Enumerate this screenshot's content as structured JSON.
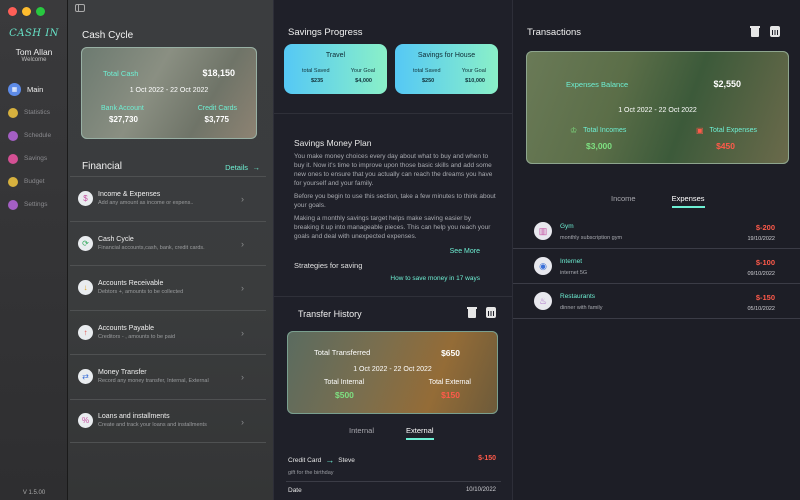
{
  "app": {
    "logo": "CASH IN",
    "user_name": "Tom Allan",
    "user_greeting": "Welcome",
    "version": "V 1.5.00"
  },
  "sidebar": {
    "items": [
      {
        "label": "Main",
        "icon": "home-icon",
        "color": "#5d8be8"
      },
      {
        "label": "Statistics",
        "icon": "chart-icon",
        "color": "#f2c94c"
      },
      {
        "label": "Schedule",
        "icon": "schedule-icon",
        "color": "#bb6bd9"
      },
      {
        "label": "Savings",
        "icon": "savings-icon",
        "color": "#eb5aa8"
      },
      {
        "label": "Budget",
        "icon": "budget-icon",
        "color": "#f2c94c"
      },
      {
        "label": "Settings",
        "icon": "gear-icon",
        "color": "#bb6bd9"
      }
    ]
  },
  "cash_cycle": {
    "title": "Cash Cycle",
    "total_label": "Total Cash",
    "total_value": "$18,150",
    "date_range": "1 Oct 2022 - 22 Oct 2022",
    "bank_label": "Bank Account",
    "bank_value": "$27,730",
    "credit_label": "Credit Cards",
    "credit_value": "$3,775"
  },
  "financial": {
    "title": "Financial",
    "details": "Details",
    "items": [
      {
        "title": "Income & Expenses",
        "subtitle": "Add any amount as income or expens..",
        "icon": "wallet-icon"
      },
      {
        "title": "Cash Cycle",
        "subtitle": "Financial accounts,cash, bank, credit cards.",
        "icon": "cash-cycle-icon"
      },
      {
        "title": "Accounts Receivable",
        "subtitle": "Debtors +, amounts to be collected",
        "icon": "receivable-icon"
      },
      {
        "title": "Accounts Payable",
        "subtitle": "Creditors - , amounts to be paid",
        "icon": "payable-icon"
      },
      {
        "title": "Money Transfer",
        "subtitle": "Record any money transfer, Internal, External",
        "icon": "transfer-icon"
      },
      {
        "title": "Loans and installments",
        "subtitle": "Create and track your loans and installments",
        "icon": "loan-icon"
      }
    ]
  },
  "savings": {
    "title": "Savings Progress",
    "goals": [
      {
        "name": "Travel",
        "saved_label": "total Saved",
        "saved": "$235",
        "goal_label": "Your Goal",
        "goal": "$4,000"
      },
      {
        "name": "Savings for House",
        "saved_label": "total Saved",
        "saved": "$250",
        "goal_label": "Your Goal",
        "goal": "$10,000"
      }
    ],
    "plan_title": "Savings Money Plan",
    "plan_paragraphs": [
      "You make money choices every day about what to buy and when to buy it. Now it's time to improve upon those basic skills and add some new ones to ensure that you actually can reach the dreams you have for yourself and your family.",
      "Before you begin to use this section, take a few minutes to think about your goals.",
      "Making a monthly savings target helps make saving easier by breaking it up into manageable pieces. This can help you reach your goals and deal with unexpected expenses."
    ],
    "see_more": "See More",
    "strategies_title": "Strategies for saving",
    "strategies_link": "How to save money in 17 ways"
  },
  "transfer_history": {
    "title": "Transfer History",
    "total_label": "Total Transferred",
    "total_value": "$650",
    "date_range": "1 Oct 2022 - 22 Oct 2022",
    "internal_label": "Total Internal",
    "internal_value": "$500",
    "external_label": "Total External",
    "external_value": "$150",
    "tabs": [
      "Internal",
      "External"
    ],
    "active_tab": 1,
    "rows": [
      {
        "from": "Credit Card",
        "to": "Steve",
        "note": "gift for the birthday",
        "amount": "$-150"
      },
      {
        "label": "Date",
        "value": "10/10/2022"
      }
    ]
  },
  "transactions": {
    "title": "Transactions",
    "balance_label": "Expenses Balance",
    "balance_value": "$2,550",
    "date_range": "1 Oct 2022 - 22 Oct 2022",
    "incomes_label": "Total Incomes",
    "incomes_value": "$3,000",
    "expenses_label": "Total Expenses",
    "expenses_value": "$450",
    "tabs": [
      "Income",
      "Expenses"
    ],
    "active_tab": 1,
    "rows": [
      {
        "name": "Gym",
        "note": "monthly subscription gym",
        "amount": "$-200",
        "date": "19/10/2022",
        "icon": "gym-icon"
      },
      {
        "name": "Internet",
        "note": "internet 5G",
        "amount": "$-100",
        "date": "09/10/2022",
        "icon": "wifi-icon"
      },
      {
        "name": "Restaurants",
        "note": "dinner with family",
        "amount": "$-150",
        "date": "05/10/2022",
        "icon": "restaurant-icon"
      }
    ]
  },
  "colors": {
    "accent": "#6ef0d4",
    "negative": "#ff5a4a",
    "positive": "#7ee081"
  }
}
